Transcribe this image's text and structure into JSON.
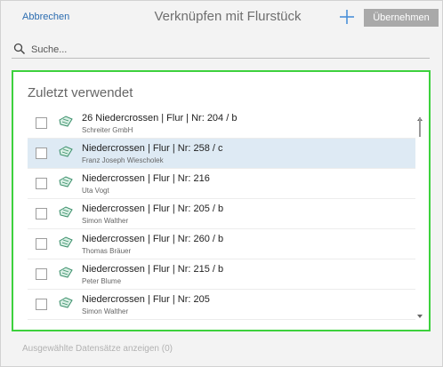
{
  "header": {
    "cancel_label": "Abbrechen",
    "title": "Verknüpfen mit Flurstück",
    "add_icon": "plus-icon",
    "apply_label": "Übernehmen"
  },
  "search": {
    "icon": "search-icon",
    "placeholder": "Suche..."
  },
  "recent": {
    "title": "Zuletzt verwendet",
    "items": [
      {
        "title": "26 Niedercrossen | Flur | Nr: 204 / b",
        "subtitle": "Schreiter GmbH",
        "selected": false
      },
      {
        "title": "Niedercrossen | Flur | Nr: 258 / c",
        "subtitle": "Franz Joseph Wiescholek",
        "selected": true
      },
      {
        "title": "Niedercrossen | Flur | Nr: 216",
        "subtitle": "Uta Vogt",
        "selected": false
      },
      {
        "title": "Niedercrossen | Flur | Nr: 205 / b",
        "subtitle": "Simon Walther",
        "selected": false
      },
      {
        "title": "Niedercrossen | Flur | Nr: 260 / b",
        "subtitle": "Thomas Bräuer",
        "selected": false
      },
      {
        "title": "Niedercrossen | Flur | Nr: 215 / b",
        "subtitle": "Peter Blume",
        "selected": false
      },
      {
        "title": "Niedercrossen | Flur | Nr: 205",
        "subtitle": "Simon Walther",
        "selected": false
      }
    ],
    "item_icon": "parcel-icon"
  },
  "footer": {
    "selected_link": "Ausgewählte Datensätze anzeigen (0)"
  },
  "colors": {
    "panel_border": "#3dd13d",
    "link": "#2b6cb0",
    "selected_row": "#deeaf4",
    "apply_button": "#a9a9a9"
  }
}
